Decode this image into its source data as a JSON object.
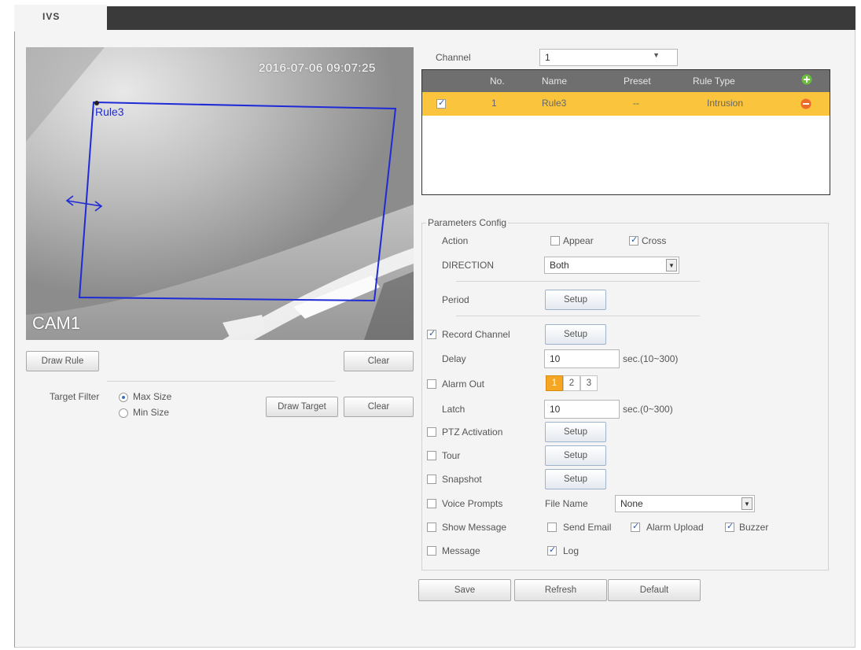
{
  "tab": "IVS",
  "video": {
    "timestamp": "2016-07-06 09:07:25",
    "rule_label": "Rule3",
    "camera_label": "CAM1"
  },
  "draw_rule_label": "Draw Rule",
  "clear_label": "Clear",
  "target_filter": {
    "label": "Target Filter",
    "max_size": "Max Size",
    "min_size": "Min Size",
    "selected": "Max Size",
    "draw_target_label": "Draw Target",
    "clear_label": "Clear"
  },
  "channel": {
    "label": "Channel",
    "value": "1"
  },
  "rules_table": {
    "headers": [
      "No.",
      "Name",
      "Preset",
      "Rule Type"
    ],
    "rows": [
      {
        "checked": true,
        "no": "1",
        "name": "Rule3",
        "preset": "--",
        "rule_type": "Intrusion"
      }
    ]
  },
  "params": {
    "legend": "Parameters Config",
    "action_label": "Action",
    "appear_label": "Appear",
    "cross_label": "Cross",
    "direction_label": "DIRECTION",
    "direction_value": "Both",
    "period_label": "Period",
    "setup_label": "Setup",
    "record_channel_label": "Record Channel",
    "delay_label": "Delay",
    "delay_value": "10",
    "delay_unit": "sec.(10~300)",
    "alarm_out_label": "Alarm Out",
    "alarm_out_options": [
      "1",
      "2",
      "3"
    ],
    "latch_label": "Latch",
    "latch_value": "10",
    "latch_unit": "sec.(0~300)",
    "ptz_label": "PTZ Activation",
    "tour_label": "Tour",
    "snapshot_label": "Snapshot",
    "voice_label": "Voice Prompts",
    "file_name_label": "File Name",
    "file_name_value": "None",
    "show_message_label": "Show Message",
    "send_email_label": "Send Email",
    "alarm_upload_label": "Alarm Upload",
    "buzzer_label": "Buzzer",
    "message_label": "Message",
    "log_label": "Log"
  },
  "footer": {
    "save": "Save",
    "refresh": "Refresh",
    "default": "Default"
  },
  "colors": {
    "topbar": "#3a3a3a",
    "selected_row": "#fac43c",
    "table_header": "#6f6f6f",
    "rule_line": "#1f2bd6",
    "alarm_active": "#f5a623"
  },
  "icons": {
    "add_rule": "plus-circle-icon",
    "delete_rule": "minus-circle-icon",
    "dropdown": "chevron-down-icon"
  }
}
